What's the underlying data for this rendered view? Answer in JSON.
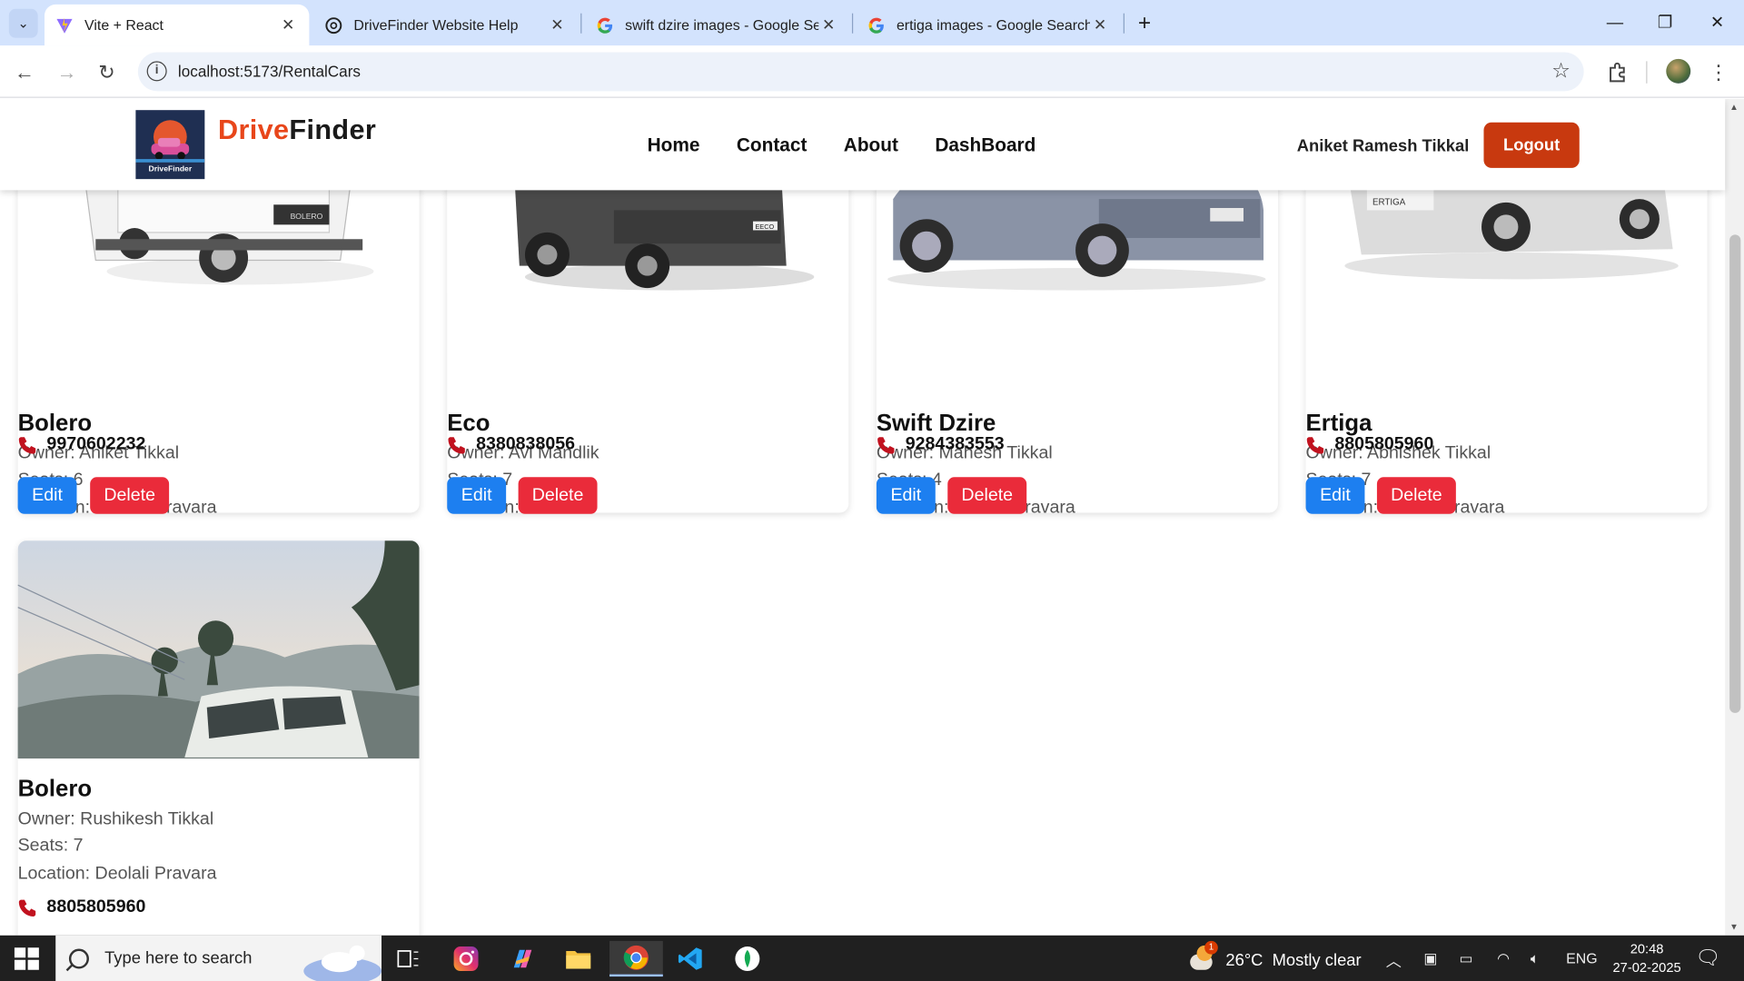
{
  "browser": {
    "tabs": [
      {
        "title": "Vite + React",
        "active": true,
        "favicon": "vite-icon"
      },
      {
        "title": "DriveFinder Website Help",
        "active": false,
        "favicon": "openai-icon"
      },
      {
        "title": "swift dzire images - Google Sea",
        "active": false,
        "favicon": "google-icon"
      },
      {
        "title": "ertiga images - Google Search",
        "active": false,
        "favicon": "google-icon"
      }
    ],
    "url": "localhost:5173/RentalCars"
  },
  "site": {
    "brand_part1": "Drive",
    "brand_part2": "Finder",
    "logo_caption": "DriveFinder",
    "nav": [
      "Home",
      "Contact",
      "About",
      "DashBoard"
    ],
    "user_name": "Aniket Ramesh Tikkal",
    "logout_label": "Logout",
    "colors": {
      "brand": "#e8461a",
      "logout": "#c8390f",
      "edit": "#1d7ff0",
      "delete": "#ea2b3a"
    }
  },
  "cars": [
    {
      "name": "Bolero",
      "owner": "Owner: Aniket Tikkal",
      "seats": "Seats: 6",
      "location": "Location: Deolali Pravara",
      "phone": "9970602232",
      "edit_label": "Edit",
      "delete_label": "Delete"
    },
    {
      "name": "Eco",
      "owner": "Owner: Avi Mandlik",
      "seats": "Seats: 7",
      "location": "Location: pune",
      "phone": "8380838056",
      "edit_label": "Edit",
      "delete_label": "Delete"
    },
    {
      "name": "Swift Dzire",
      "owner": "Owner: Mahesh Tikkal",
      "seats": "Seats: 4",
      "location": "Location: Deolali Pravara",
      "phone": "9284383553",
      "edit_label": "Edit",
      "delete_label": "Delete"
    },
    {
      "name": "Ertiga",
      "owner": "Owner: Abhishek Tikkal",
      "seats": "Seats: 7",
      "location": "Location: Deolali Pravara",
      "phone": "8805805960",
      "edit_label": "Edit",
      "delete_label": "Delete"
    },
    {
      "name": "Bolero",
      "owner": "Owner: Rushikesh Tikkal",
      "seats": "Seats: 7",
      "location": "Location: Deolali Pravara",
      "phone": "8805805960"
    }
  ],
  "taskbar": {
    "search_placeholder": "Type here to search",
    "weather": "26°C  Mostly clear",
    "weather_badge": "1",
    "language": "ENG",
    "time": "20:48",
    "date": "27-02-2025"
  }
}
